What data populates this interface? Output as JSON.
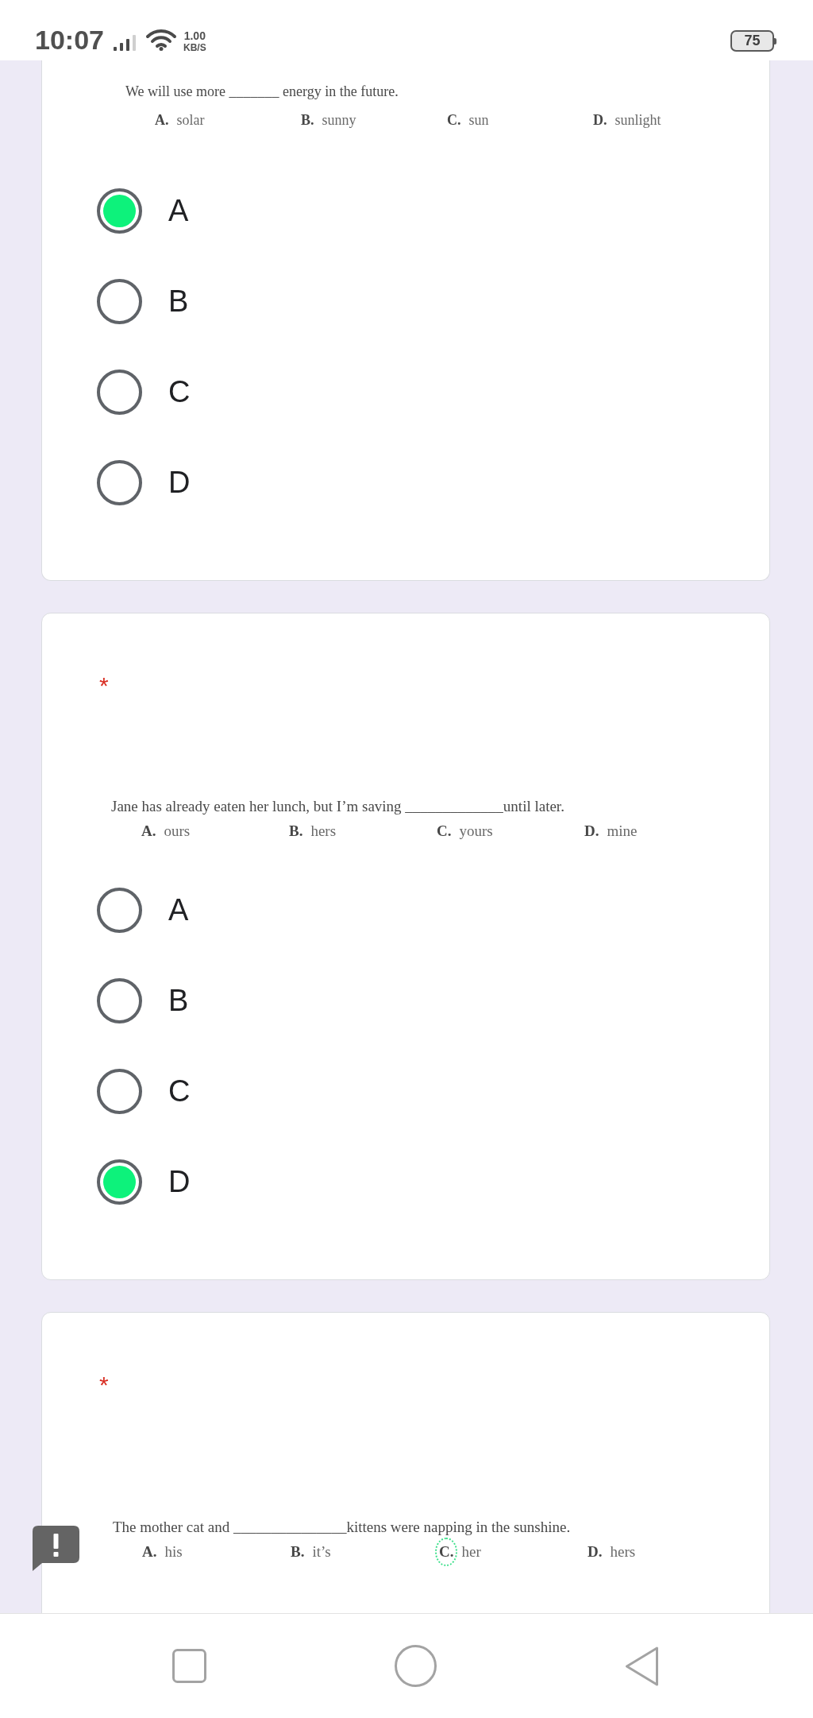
{
  "status_bar": {
    "time": "10:07",
    "speed_value": "1.00",
    "speed_unit": "KB/S",
    "battery": "75"
  },
  "questions": [
    {
      "prompt": "We will use more _______ energy in the future.",
      "options": [
        {
          "letter": "A.",
          "text": "solar",
          "circled": false
        },
        {
          "letter": "B.",
          "text": "sunny",
          "circled": false
        },
        {
          "letter": "C.",
          "text": "sun",
          "circled": false
        },
        {
          "letter": "D.",
          "text": "sunlight",
          "circled": false
        }
      ],
      "choices": [
        {
          "label": "A",
          "selected": true
        },
        {
          "label": "B",
          "selected": false
        },
        {
          "label": "C",
          "selected": false
        },
        {
          "label": "D",
          "selected": false
        }
      ]
    },
    {
      "required_mark": "*",
      "prompt": "Jane has already eaten her lunch, but I’m saving _____________until later.",
      "options": [
        {
          "letter": "A.",
          "text": "ours",
          "circled": false
        },
        {
          "letter": "B.",
          "text": "hers",
          "circled": false
        },
        {
          "letter": "C.",
          "text": "yours",
          "circled": false
        },
        {
          "letter": "D.",
          "text": "mine",
          "circled": false
        }
      ],
      "choices": [
        {
          "label": "A",
          "selected": false
        },
        {
          "label": "B",
          "selected": false
        },
        {
          "label": "C",
          "selected": false
        },
        {
          "label": "D",
          "selected": true
        }
      ]
    },
    {
      "required_mark": "*",
      "prompt": "The mother cat and _______________kittens were napping in the sunshine.",
      "options": [
        {
          "letter": "A.",
          "text": "his",
          "circled": false
        },
        {
          "letter": "B.",
          "text": "it’s",
          "circled": false
        },
        {
          "letter": "C.",
          "text": "her",
          "circled": true
        },
        {
          "letter": "D.",
          "text": "hers",
          "circled": false
        }
      ]
    }
  ]
}
